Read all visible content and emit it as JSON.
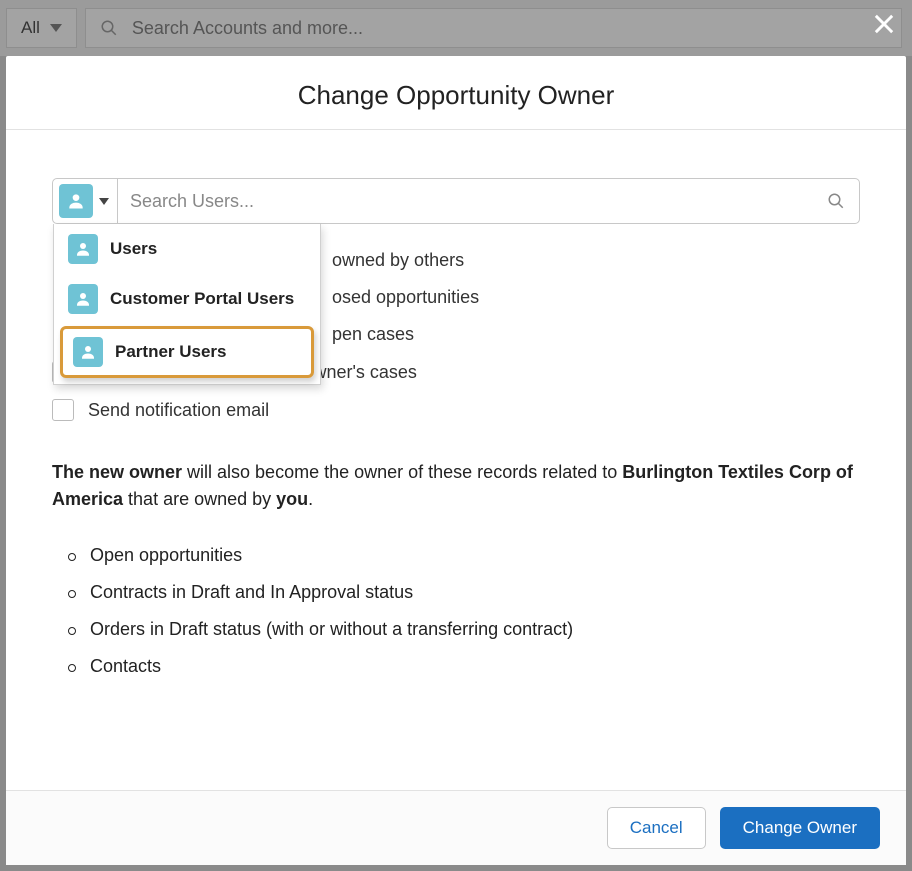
{
  "background": {
    "filter_label": "All",
    "search_placeholder": "Search Accounts and more..."
  },
  "modal": {
    "title": "Change Opportunity Owner",
    "owner_search_placeholder": "Search Users...",
    "dropdown": {
      "items": [
        {
          "label": "Users"
        },
        {
          "label": "Customer Portal Users"
        },
        {
          "label": "Partner Users"
        }
      ]
    },
    "checkboxes": [
      {
        "partial_label": "owned by others"
      },
      {
        "partial_label": "osed opportunities"
      },
      {
        "partial_label": "pen cases"
      },
      {
        "label": "Transfer all of this account owner's cases"
      },
      {
        "label": "Send notification email"
      }
    ],
    "description": {
      "lead_bold": "The new owner",
      "mid_1": " will also become the owner of these records related to ",
      "record_bold": "Burlington Textiles Corp of America",
      "mid_2": " that are owned by ",
      "you_bold": "you",
      "tail": "."
    },
    "bullets": [
      "Open opportunities",
      "Contracts in Draft and In Approval status",
      "Orders in Draft status (with or without a transferring contract)",
      "Contacts"
    ],
    "buttons": {
      "cancel": "Cancel",
      "primary": "Change Owner"
    }
  }
}
